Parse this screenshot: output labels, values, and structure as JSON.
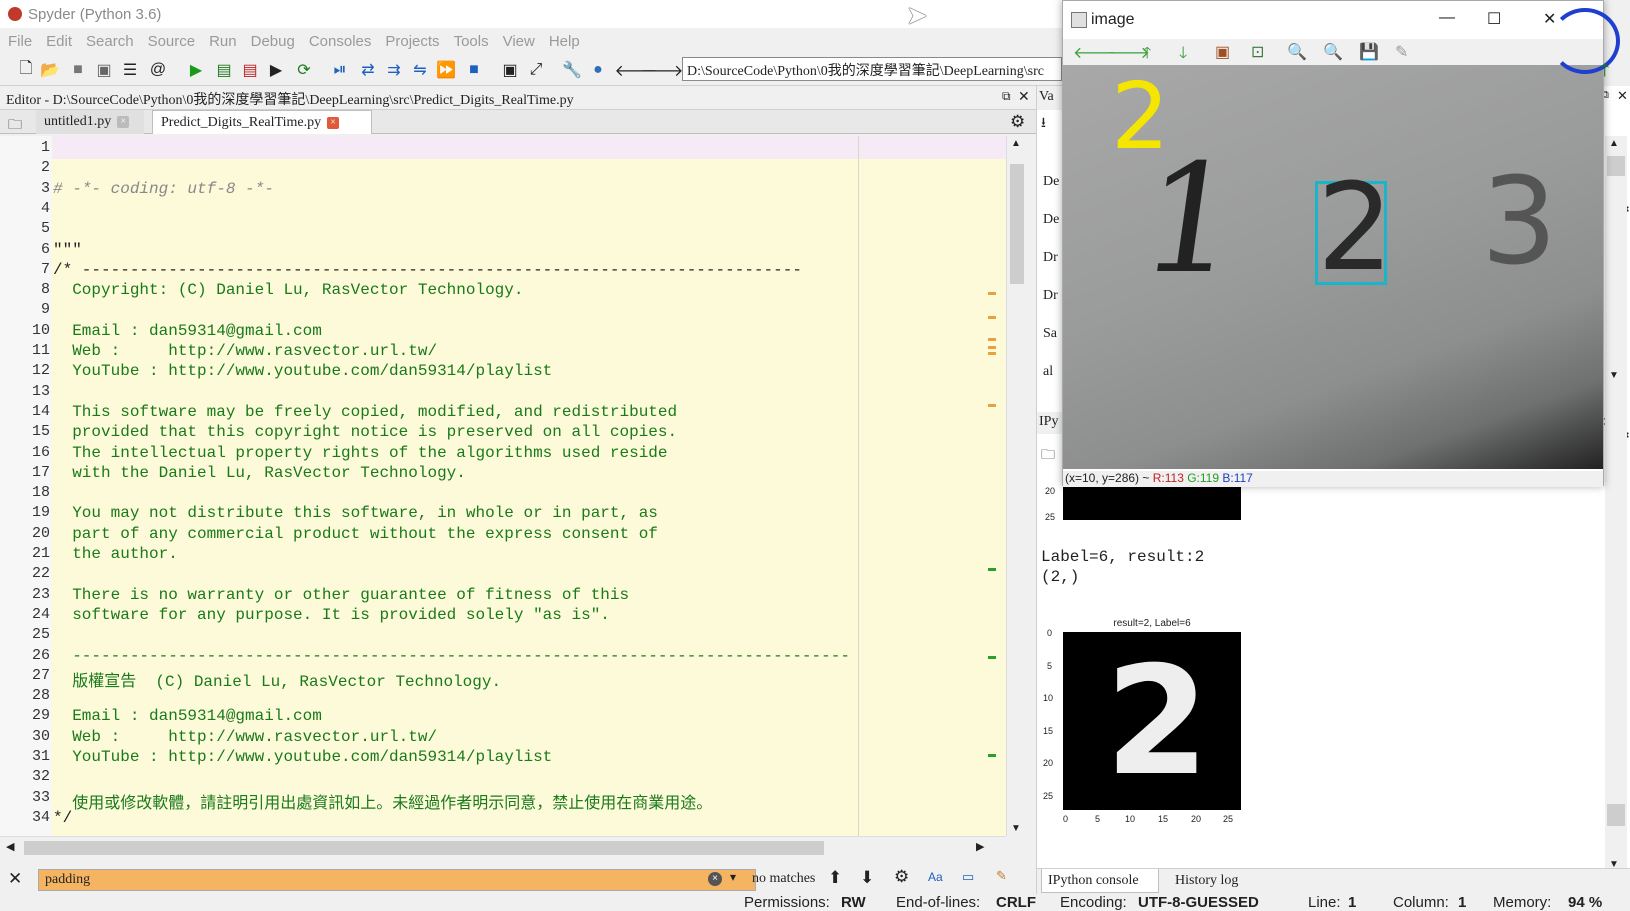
{
  "app": {
    "title": "Spyder (Python 3.6)"
  },
  "menu": [
    "File",
    "Edit",
    "Search",
    "Source",
    "Run",
    "Debug",
    "Consoles",
    "Projects",
    "Tools",
    "View",
    "Help"
  ],
  "toolbar": {
    "path": "D:\\SourceCode\\Python\\0我的深度學習筆記\\DeepLearning\\src"
  },
  "editor": {
    "header": "Editor - D:\\SourceCode\\Python\\0我的深度學習筆記\\DeepLearning\\src\\Predict_Digits_RealTime.py",
    "tabs": [
      {
        "label": "untitled1.py"
      },
      {
        "label": "Predict_Digits_RealTime.py"
      }
    ],
    "lines": [
      {
        "n": "1",
        "t": ""
      },
      {
        "n": "2",
        "t": ""
      },
      {
        "n": "3",
        "t": "# -*- coding: utf-8 -*-"
      },
      {
        "n": "4",
        "t": ""
      },
      {
        "n": "5",
        "t": ""
      },
      {
        "n": "6",
        "t": "\"\"\""
      },
      {
        "n": "7",
        "t": "/* ---------------------------------------------------------------------------"
      },
      {
        "n": "8",
        "t": "  Copyright: (C) Daniel Lu, RasVector Technology."
      },
      {
        "n": "9",
        "t": ""
      },
      {
        "n": "10",
        "t": "  Email : dan59314@gmail.com"
      },
      {
        "n": "11",
        "t": "  Web :     http://www.rasvector.url.tw/"
      },
      {
        "n": "12",
        "t": "  YouTube : http://www.youtube.com/dan59314/playlist"
      },
      {
        "n": "13",
        "t": ""
      },
      {
        "n": "14",
        "t": "  This software may be freely copied, modified, and redistributed"
      },
      {
        "n": "15",
        "t": "  provided that this copyright notice is preserved on all copies."
      },
      {
        "n": "16",
        "t": "  The intellectual property rights of the algorithms used reside"
      },
      {
        "n": "17",
        "t": "  with the Daniel Lu, RasVector Technology."
      },
      {
        "n": "18",
        "t": ""
      },
      {
        "n": "19",
        "t": "  You may not distribute this software, in whole or in part, as"
      },
      {
        "n": "20",
        "t": "  part of any commercial product without the express consent of"
      },
      {
        "n": "21",
        "t": "  the author."
      },
      {
        "n": "22",
        "t": ""
      },
      {
        "n": "23",
        "t": "  There is no warranty or other guarantee of fitness of this"
      },
      {
        "n": "24",
        "t": "  software for any purpose. It is provided solely \"as is\"."
      },
      {
        "n": "25",
        "t": ""
      },
      {
        "n": "26",
        "t": "  ---------------------------------------------------------------------------------"
      },
      {
        "n": "27",
        "t": "  版權宣告  (C) Daniel Lu, RasVector Technology."
      },
      {
        "n": "28",
        "t": ""
      },
      {
        "n": "29",
        "t": "  Email : dan59314@gmail.com"
      },
      {
        "n": "30",
        "t": "  Web :     http://www.rasvector.url.tw/"
      },
      {
        "n": "31",
        "t": "  YouTube : http://www.youtube.com/dan59314/playlist"
      },
      {
        "n": "32",
        "t": ""
      },
      {
        "n": "33",
        "t": "  使用或修改軟體，請註明引用出處資訊如上。未經過作者明示同意，禁止使用在商業用途。"
      },
      {
        "n": "34",
        "t": "*/"
      }
    ]
  },
  "find": {
    "value": "padding",
    "status": "no matches",
    "case_label": "Aa"
  },
  "status": {
    "permissions_label": "Permissions:",
    "permissions": "RW",
    "eol_label": "End-of-lines:",
    "eol": "CRLF",
    "encoding_label": "Encoding:",
    "encoding": "UTF-8-GUESSED",
    "line_label": "Line:",
    "line": "1",
    "column_label": "Column:",
    "column": "1",
    "memory_label": "Memory:",
    "memory": "94 %"
  },
  "right": {
    "var_tab": "Va",
    "var_rows": [
      "De",
      "De",
      "Dr",
      "Dr",
      "Sa",
      "al"
    ],
    "ipy_tab": "IPy",
    "console_output": [
      "Label=6, result:2",
      "(2,)"
    ],
    "plot_title": "result=2, Label=6",
    "plot_digit": "2",
    "yticks_top": [
      "20",
      "25"
    ],
    "yticks": [
      "0",
      "5",
      "10",
      "15",
      "20",
      "25"
    ],
    "xticks": [
      "0",
      "5",
      "10",
      "15",
      "20",
      "25"
    ],
    "bottom_tabs": [
      "IPython console",
      "History log"
    ]
  },
  "imagewin": {
    "title": "image",
    "predicted": "2",
    "digits": [
      "1",
      "2",
      "3"
    ],
    "status": "(x=10, y=286) ~",
    "r": "R:113",
    "g": "G:119",
    "b": "B:117"
  }
}
